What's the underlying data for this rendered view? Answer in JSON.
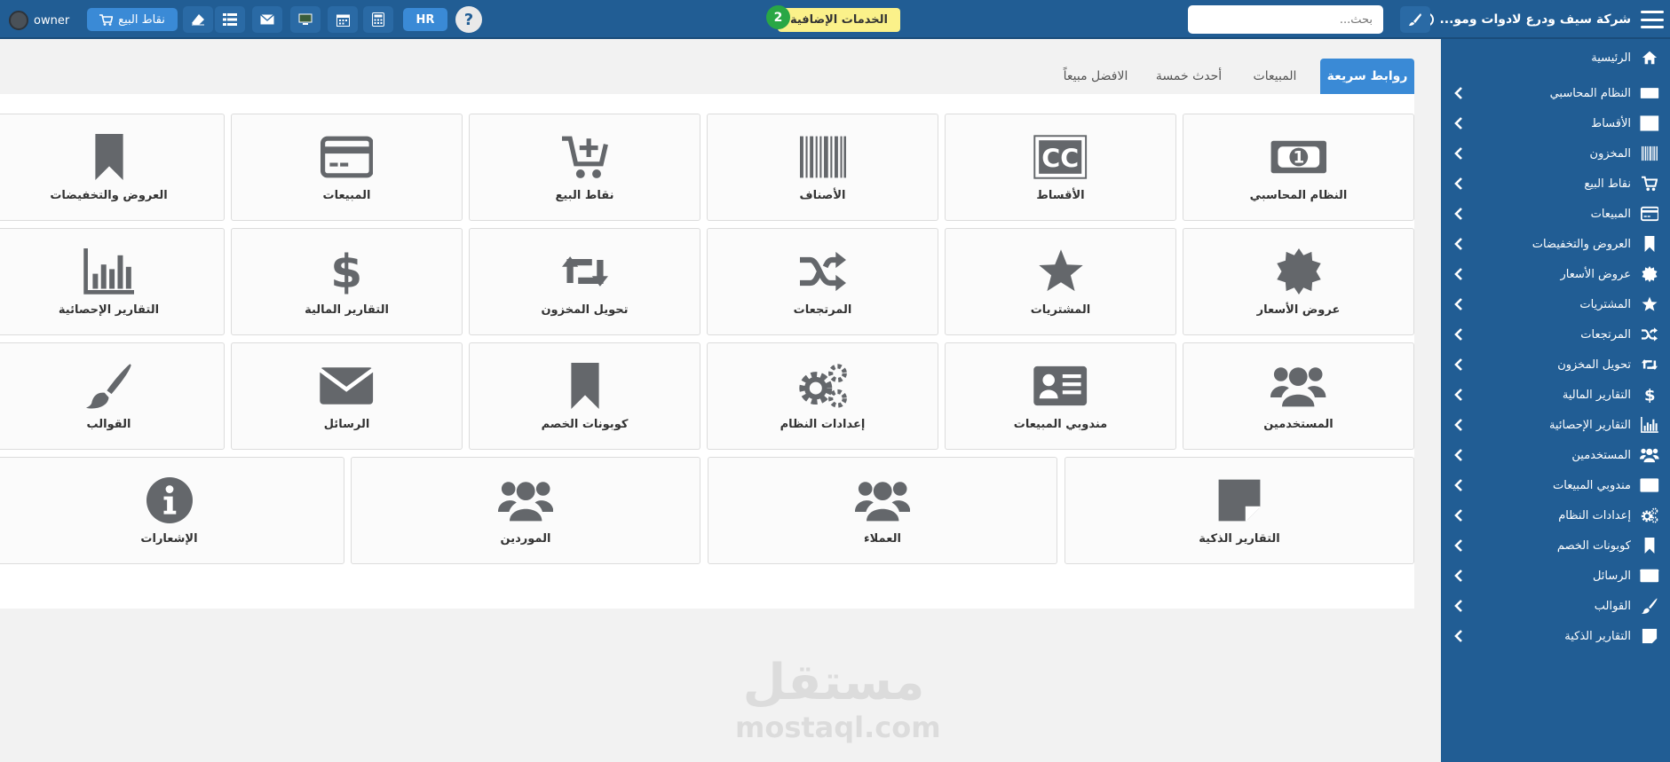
{
  "topbar": {
    "company_name": "شركة سيف ودرع لادوات ومو...",
    "search_placeholder": "بحث...",
    "services_label": "الخدمات الإضافية",
    "services_badge": "2",
    "help_label": "?",
    "hr_label": "HR",
    "pos_label": "نقاط البيع",
    "user_name": "owner"
  },
  "colors": {
    "primary": "#215d94",
    "accent": "#3a8ad6",
    "icon": "#64676b",
    "badge": "#29a745",
    "highlight": "#fbf18a"
  },
  "sidebar": {
    "items": [
      {
        "label": "الرئيسية",
        "icon": "home-icon"
      },
      {
        "label": "النظام المحاسبي",
        "icon": "money-icon"
      },
      {
        "label": "الأقساط",
        "icon": "cc-icon"
      },
      {
        "label": "المخزون",
        "icon": "barcode-icon"
      },
      {
        "label": "نقاط البيع",
        "icon": "cart-icon"
      },
      {
        "label": "المبيعات",
        "icon": "credit-card-icon"
      },
      {
        "label": "العروض والتخفيضات",
        "icon": "bookmark-icon"
      },
      {
        "label": "عروض الأسعار",
        "icon": "certificate-icon"
      },
      {
        "label": "المشتريات",
        "icon": "star-icon"
      },
      {
        "label": "المرتجعات",
        "icon": "shuffle-icon"
      },
      {
        "label": "تحويل المخزون",
        "icon": "retweet-icon"
      },
      {
        "label": "التقارير المالية",
        "icon": "dollar-icon"
      },
      {
        "label": "التقارير الإحصائية",
        "icon": "bar-chart-icon"
      },
      {
        "label": "المستخدمين",
        "icon": "users-icon"
      },
      {
        "label": "مندوبي المبيعات",
        "icon": "id-card-icon"
      },
      {
        "label": "إعدادات النظام",
        "icon": "gears-icon"
      },
      {
        "label": "كوبونات الخصم",
        "icon": "bookmark-icon"
      },
      {
        "label": "الرسائل",
        "icon": "envelope-icon"
      },
      {
        "label": "القوالب",
        "icon": "paint-brush-icon"
      },
      {
        "label": "التقارير الذكية",
        "icon": "sticky-note-icon"
      }
    ]
  },
  "tabs": [
    {
      "label": "روابط سريعة",
      "active": true
    },
    {
      "label": "المبيعات",
      "active": false
    },
    {
      "label": "أحدث خمسة",
      "active": false
    },
    {
      "label": "الافضل مبيعاً",
      "active": false
    }
  ],
  "cards": [
    {
      "label": "النظام المحاسبي",
      "icon": "money-icon"
    },
    {
      "label": "الأقساط",
      "icon": "cc-icon"
    },
    {
      "label": "الأصناف",
      "icon": "barcode-icon"
    },
    {
      "label": "نقاط البيع",
      "icon": "cart-plus-icon"
    },
    {
      "label": "المبيعات",
      "icon": "credit-card-icon"
    },
    {
      "label": "العروض والتخفيضات",
      "icon": "bookmark-icon"
    },
    {
      "label": "عروض الأسعار",
      "icon": "certificate-icon"
    },
    {
      "label": "المشتريات",
      "icon": "star-icon"
    },
    {
      "label": "المرتجعات",
      "icon": "shuffle-icon"
    },
    {
      "label": "تحويل المخزون",
      "icon": "retweet-icon"
    },
    {
      "label": "التقارير المالية",
      "icon": "dollar-icon"
    },
    {
      "label": "التقارير الإحصائية",
      "icon": "bar-chart-icon"
    },
    {
      "label": "المستخدمين",
      "icon": "users-icon"
    },
    {
      "label": "مندوبي المبيعات",
      "icon": "id-card-icon"
    },
    {
      "label": "إعدادات النظام",
      "icon": "gears-icon"
    },
    {
      "label": "كوبونات الخصم",
      "icon": "bookmark-icon"
    },
    {
      "label": "الرسائل",
      "icon": "envelope-icon"
    },
    {
      "label": "القوالب",
      "icon": "paint-brush-icon"
    },
    {
      "label": "التقارير الذكية",
      "icon": "sticky-note-icon"
    },
    {
      "label": "العملاء",
      "icon": "users-icon"
    },
    {
      "label": "الموردين",
      "icon": "users-icon"
    },
    {
      "label": "الإشعارات",
      "icon": "info-icon"
    }
  ],
  "watermark": {
    "arabic": "مستقل",
    "latin": "mostaql.com"
  }
}
